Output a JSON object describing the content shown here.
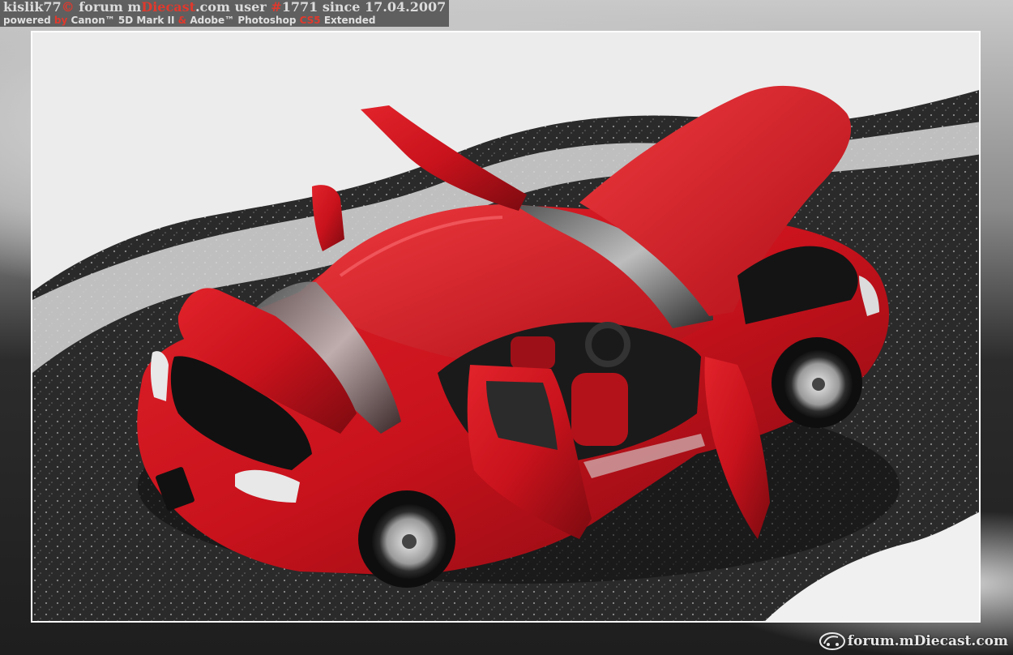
{
  "watermark": {
    "user": "kislik77",
    "copy": "©",
    "forum_word": "forum",
    "site_prefix": "m",
    "site_accent": "Diecast",
    "site_suffix": ".com",
    "user_word": "user",
    "user_number_prefix": "#",
    "user_number": "1771",
    "since": "since 17.04.2007",
    "powered": "powered",
    "by": "by",
    "camera": "Canon™ 5D Mark II",
    "amp": "&",
    "software_brand": "Adobe™ Photoshop",
    "software_version": "CS5",
    "software_suffix": "Extended"
  },
  "logo": {
    "text": "forum.mDiecast.com",
    "icon": "mdiecast-logo-icon"
  },
  "photo": {
    "subject": "red-sports-car-model",
    "colors": {
      "car": "#c8121c",
      "car_dark": "#7d0a10",
      "asphalt": "#2a2a2a",
      "snow": "#ececec",
      "frame": "#ffffff",
      "accent": "#e0392d"
    }
  }
}
